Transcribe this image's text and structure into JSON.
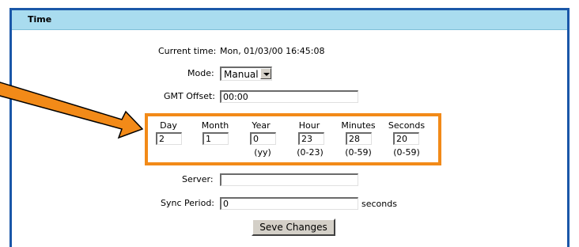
{
  "panel": {
    "title": "Time"
  },
  "current_time": {
    "label": "Current time:",
    "value": "Mon, 01/03/00 16:45:08"
  },
  "mode": {
    "label": "Mode:",
    "selected": "Manual"
  },
  "gmt_offset": {
    "label": "GMT Offset:",
    "value": "00:00"
  },
  "datetime_fields": [
    {
      "label": "Day",
      "value": "2",
      "range": ""
    },
    {
      "label": "Month",
      "value": "1",
      "range": ""
    },
    {
      "label": "Year",
      "value": "0",
      "range": "(yy)"
    },
    {
      "label": "Hour",
      "value": "23",
      "range": "(0-23)"
    },
    {
      "label": "Minutes",
      "value": "28",
      "range": "(0-59)"
    },
    {
      "label": "Seconds",
      "value": "20",
      "range": "(0-59)"
    }
  ],
  "server": {
    "label": "Server:",
    "value": ""
  },
  "sync_period": {
    "label": "Sync Period:",
    "value": "0",
    "unit": "seconds"
  },
  "save_button": {
    "label": "Seve Changes"
  },
  "annotation": {
    "highlight_color": "#f28a18",
    "panel_border_color": "#1a57a8",
    "header_color": "#a9dcef"
  }
}
